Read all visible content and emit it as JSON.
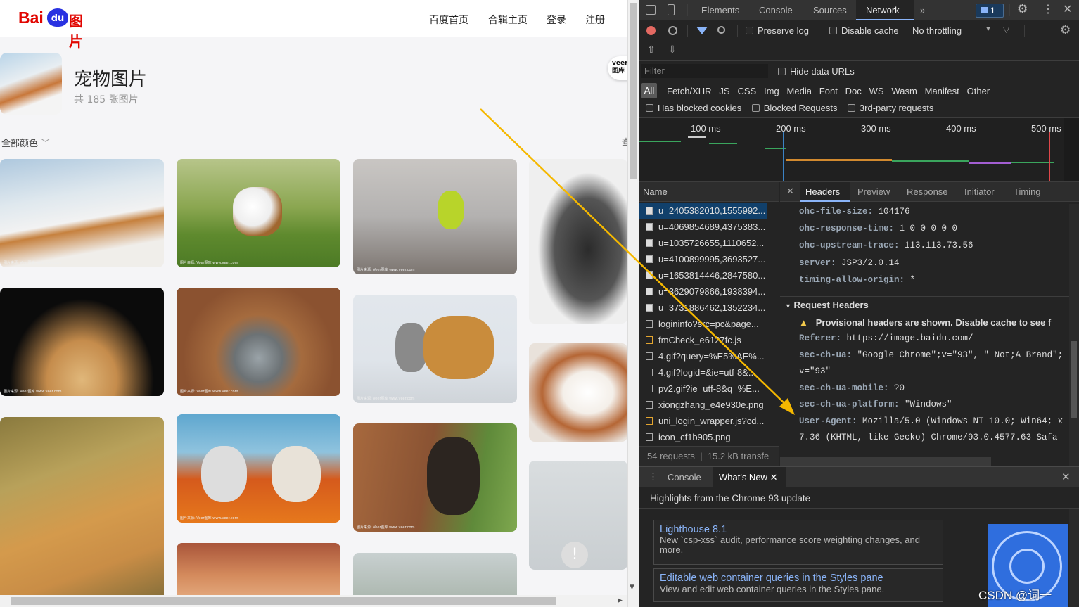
{
  "site": {
    "logo_text": "Bai",
    "logo_text2": "du",
    "logo_cn": "图片",
    "nav": [
      "百度首页",
      "合辑主页",
      "登录",
      "注册"
    ],
    "album_title": "宠物图片",
    "album_count": "共 185 张图片",
    "filter": "全部颜色",
    "veer": "veer\n图库",
    "right_cut": "查",
    "watermark": "图片来源: Veer图库 www.veer.com"
  },
  "devtools": {
    "tabs": [
      "Elements",
      "Console",
      "Sources",
      "Network"
    ],
    "badge": "1",
    "preserve_log": "Preserve log",
    "disable_cache": "Disable cache",
    "throttling": "No throttling",
    "filter_placeholder": "Filter",
    "hide_data_urls": "Hide data URLs",
    "types": [
      "All",
      "Fetch/XHR",
      "JS",
      "CSS",
      "Img",
      "Media",
      "Font",
      "Doc",
      "WS",
      "Wasm",
      "Manifest",
      "Other"
    ],
    "blocked_cookies": "Has blocked cookies",
    "blocked_requests": "Blocked Requests",
    "third_party": "3rd-party requests",
    "timeline": [
      "100 ms",
      "200 ms",
      "300 ms",
      "400 ms",
      "500 ms"
    ],
    "name_header": "Name",
    "requests": [
      "u=2405382010,1555992...",
      "u=4069854689,4375383...",
      "u=1035726655,1110652...",
      "u=4100899995,3693527...",
      "u=1653814446,2847580...",
      "u=3629079866,1938394...",
      "u=3731886462,1352234...",
      "logininfo?src=pc&page...",
      "fmCheck_e6127fc.js",
      "4.gif?query=%E5%AE%...",
      "4.gif?logid=&ie=utf-8&...",
      "pv2.gif?ie=utf-8&q=%E...",
      "xiongzhang_e4e930e.png",
      "uni_login_wrapper.js?cd...",
      "icon_cf1b905.png"
    ],
    "status_requests": "54 requests",
    "status_transfer": "15.2 kB transfe",
    "detail_tabs": [
      "Headers",
      "Preview",
      "Response",
      "Initiator",
      "Timing"
    ],
    "response_headers": [
      [
        "ohc-file-size:",
        "104176"
      ],
      [
        "ohc-response-time:",
        "1 0 0 0 0 0"
      ],
      [
        "ohc-upstream-trace:",
        "113.113.73.56"
      ],
      [
        "server:",
        "JSP3/2.0.14"
      ],
      [
        "timing-allow-origin:",
        "*"
      ]
    ],
    "request_section": "Request Headers",
    "provisional": "Provisional headers are shown. Disable cache to see f",
    "request_headers": [
      [
        "Referer:",
        "https://image.baidu.com/"
      ],
      [
        "sec-ch-ua:",
        "\"Google Chrome\";v=\"93\", \" Not;A Brand\";"
      ],
      [
        "",
        "v=\"93\""
      ],
      [
        "sec-ch-ua-mobile:",
        "?0"
      ],
      [
        "sec-ch-ua-platform:",
        "\"Windows\""
      ],
      [
        "User-Agent:",
        "Mozilla/5.0 (Windows NT 10.0; Win64; x"
      ],
      [
        "",
        "7.36 (KHTML, like Gecko) Chrome/93.0.4577.63 Safa"
      ]
    ],
    "drawer_tabs": [
      "Console",
      "What's New"
    ],
    "highlights": "Highlights from the Chrome 93 update",
    "card1_title": "Lighthouse 8.1",
    "card1_desc": "New `csp-xss` audit, performance score weighting changes, and more.",
    "card2_title": "Editable web container queries in the Styles pane",
    "card2_desc": "View and edit web container queries in the Styles pane.",
    "csdn": "CSDN @词一"
  },
  "colors": {
    "arrow": "#f5b800",
    "accent": "#8ab4f8",
    "baidu_red": "#e10601"
  }
}
